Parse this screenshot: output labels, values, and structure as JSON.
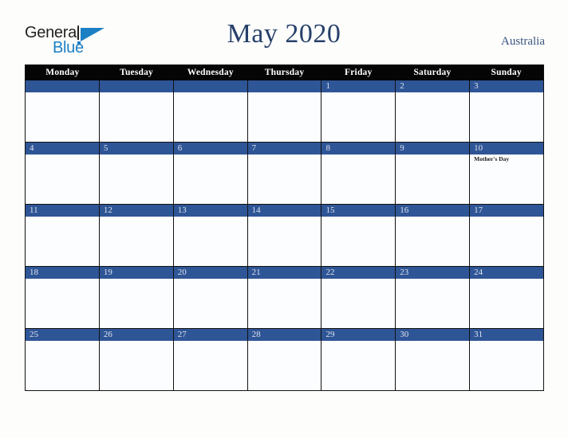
{
  "brand": {
    "line1": "General",
    "line2": "Blue",
    "mark": "triangle-logo-mark"
  },
  "header": {
    "title": "May 2020",
    "region": "Australia"
  },
  "colors": {
    "page_background": "#fdfdfb",
    "header_row_background": "#050505",
    "date_bar_blue": "#2e5596",
    "cell_background": "#fcfdfe",
    "grid_border": "#121212",
    "title_navy": "#27406b",
    "region_navy": "#3b5580",
    "brand_blue": "#1c7fc4",
    "brand_dark": "#231f20"
  },
  "calendar": {
    "weekdays": [
      "Monday",
      "Tuesday",
      "Wednesday",
      "Thursday",
      "Friday",
      "Saturday",
      "Sunday"
    ],
    "weeks": [
      [
        {
          "day": "",
          "events": []
        },
        {
          "day": "",
          "events": []
        },
        {
          "day": "",
          "events": []
        },
        {
          "day": "",
          "events": []
        },
        {
          "day": "1",
          "events": []
        },
        {
          "day": "2",
          "events": []
        },
        {
          "day": "3",
          "events": []
        }
      ],
      [
        {
          "day": "4",
          "events": []
        },
        {
          "day": "5",
          "events": []
        },
        {
          "day": "6",
          "events": []
        },
        {
          "day": "7",
          "events": []
        },
        {
          "day": "8",
          "events": []
        },
        {
          "day": "9",
          "events": []
        },
        {
          "day": "10",
          "events": [
            "Mother's Day"
          ]
        }
      ],
      [
        {
          "day": "11",
          "events": []
        },
        {
          "day": "12",
          "events": []
        },
        {
          "day": "13",
          "events": []
        },
        {
          "day": "14",
          "events": []
        },
        {
          "day": "15",
          "events": []
        },
        {
          "day": "16",
          "events": []
        },
        {
          "day": "17",
          "events": []
        }
      ],
      [
        {
          "day": "18",
          "events": []
        },
        {
          "day": "19",
          "events": []
        },
        {
          "day": "20",
          "events": []
        },
        {
          "day": "21",
          "events": []
        },
        {
          "day": "22",
          "events": []
        },
        {
          "day": "23",
          "events": []
        },
        {
          "day": "24",
          "events": []
        }
      ],
      [
        {
          "day": "25",
          "events": []
        },
        {
          "day": "26",
          "events": []
        },
        {
          "day": "27",
          "events": []
        },
        {
          "day": "28",
          "events": []
        },
        {
          "day": "29",
          "events": []
        },
        {
          "day": "30",
          "events": []
        },
        {
          "day": "31",
          "events": []
        }
      ]
    ]
  }
}
